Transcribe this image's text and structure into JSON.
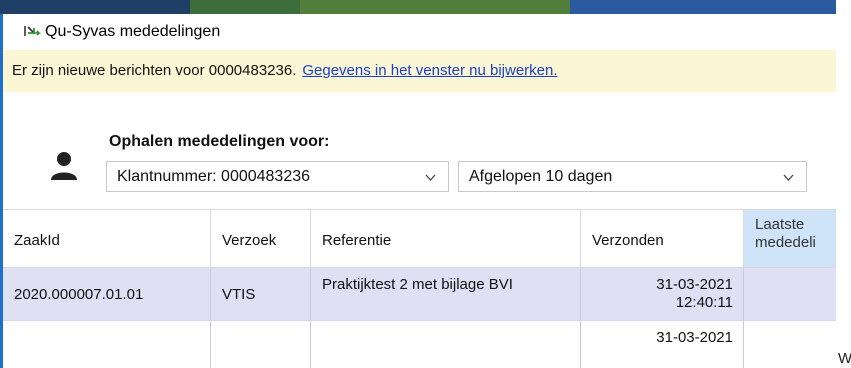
{
  "window": {
    "title": "Qu-Syvas mededelingen"
  },
  "infobar": {
    "message": "Er zijn nieuwe berichten voor 0000483236.",
    "link": "Gegevens in het venster nu bijwerken."
  },
  "fetch": {
    "label": "Ophalen mededelingen voor:",
    "customer_select": "Klantnummer: 0000483236",
    "period_select": "Afgelopen 10 dagen"
  },
  "table": {
    "columns": [
      "ZaakId",
      "Verzoek",
      "Referentie",
      "Verzonden",
      "Laatste mededeli"
    ],
    "rows": [
      {
        "zaakid": "2020.000007.01.01",
        "verzoek": "VTIS",
        "referentie": "Praktijktest 2 met bijlage BVI",
        "verzonden_date": "31-03-2021",
        "verzonden_time": "12:40:11",
        "laatste": ""
      }
    ],
    "next_row_partial": "31-03-2021"
  },
  "stray_text": "W",
  "colors": {
    "accent": "#1e70c8",
    "infobar": "#fbf7d5",
    "selected_row": "#dfe0f4",
    "highlight_header": "#cfe4f8",
    "link": "#1a3fcf"
  }
}
